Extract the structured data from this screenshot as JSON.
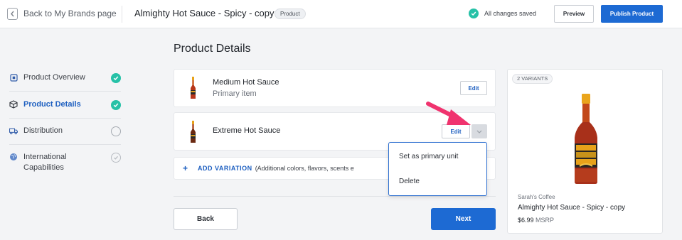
{
  "header": {
    "back_label": "Back to My Brands page",
    "product_title": "Almighty Hot Sauce - Spicy - copy",
    "type_badge": "Product",
    "save_status": "All changes saved",
    "preview_label": "Preview",
    "publish_label": "Publish Product"
  },
  "sidebar": {
    "items": [
      {
        "label": "Product Overview",
        "status": "complete"
      },
      {
        "label": "Product Details",
        "status": "complete",
        "active": true
      },
      {
        "label": "Distribution",
        "status": "incomplete"
      },
      {
        "label": "International Capabilities",
        "status": "optional"
      }
    ]
  },
  "main": {
    "heading": "Product Details",
    "items": [
      {
        "name": "Medium Hot Sauce",
        "subtitle": "Primary item",
        "edit_label": "Edit"
      },
      {
        "name": "Extreme Hot Sauce",
        "edit_label": "Edit"
      }
    ],
    "add_variation": {
      "plus": "+",
      "label": "ADD VARIATION",
      "note": "(Additional colors, flavors, scents e"
    },
    "dropdown": {
      "items": [
        "Set as primary unit",
        "Delete"
      ]
    },
    "back_label": "Back",
    "next_label": "Next"
  },
  "preview": {
    "variants_badge": "2 VARIANTS",
    "brand": "Sarah's Coffee",
    "title": "Almighty Hot Sauce - Spicy - copy",
    "price": "$6.99",
    "price_suffix": "MSRP"
  },
  "colors": {
    "primary": "#1d6ad3",
    "success": "#26c1a7",
    "annotation_arrow": "#f0336e"
  }
}
